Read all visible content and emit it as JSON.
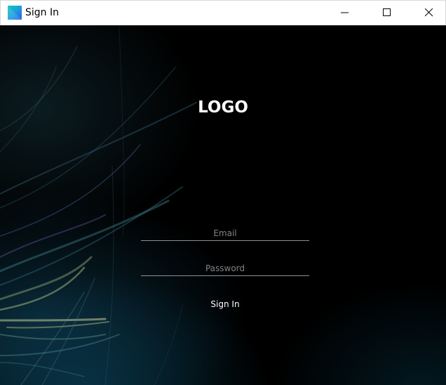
{
  "window": {
    "title": "Sign In",
    "app_icon": "app-logo-icon",
    "controls": [
      "minimize-icon",
      "maximize-icon",
      "close-icon"
    ]
  },
  "login": {
    "logo_text": "LOGO",
    "email_placeholder": "Email",
    "email_value": "",
    "password_placeholder": "Password",
    "password_value": "",
    "signin_label": "Sign In"
  },
  "colors": {
    "background": "#000000",
    "text": "#ffffff",
    "placeholder": "#7f8487",
    "underline": "#8a9196",
    "accent_teal": "#0a4a63"
  }
}
